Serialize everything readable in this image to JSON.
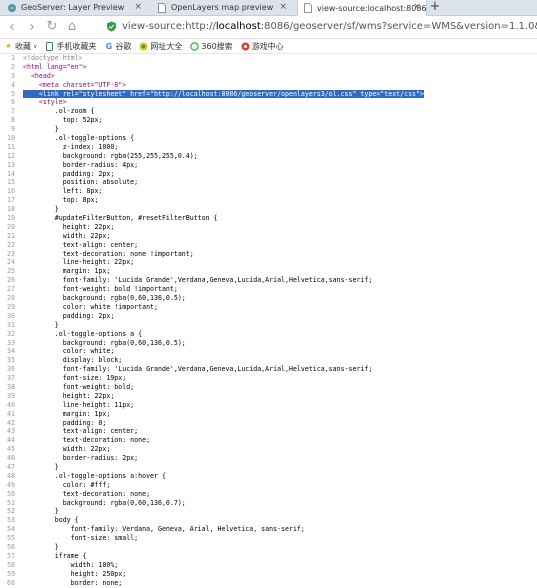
{
  "tabs": [
    {
      "title": "GeoServer: Layer Preview",
      "icon": "geoserver-icon",
      "active": false
    },
    {
      "title": "OpenLayers map preview",
      "icon": "page-icon",
      "active": false
    },
    {
      "title": "view-source:localhost:8086/ge",
      "icon": "page-icon",
      "active": true
    }
  ],
  "new_tab_label": "+",
  "close_label": "×",
  "nav": {
    "back": "‹",
    "forward": "›",
    "reload": "↻",
    "home": "⌂",
    "url_prefix": "view-source:http://",
    "url_host": "localhost",
    "url_rest": ":8086/geoserver/sf/wms?service=WMS&version=1.1.0&request=Ge"
  },
  "bookmarks": [
    {
      "label": "收藏",
      "icon": "star-icon"
    },
    {
      "label": "手机收藏夹",
      "icon": "phone-icon"
    },
    {
      "label": "谷歌",
      "icon": "google-icon"
    },
    {
      "label": "网址大全",
      "icon": "web-icon"
    },
    {
      "label": "360搜索",
      "icon": "search-360-icon"
    },
    {
      "label": "游戏中心",
      "icon": "game-icon"
    }
  ],
  "source_lines": [
    {
      "n": "1",
      "text": "<!doctype html>",
      "kind": "comment"
    },
    {
      "n": "2",
      "text": "<html lang=\"en\">",
      "kind": "tag"
    },
    {
      "n": "3",
      "text": "  <head>",
      "kind": "tag"
    },
    {
      "n": "4",
      "text": "    <meta charset=\"UTF-8\">",
      "kind": "tag"
    },
    {
      "n": "5",
      "text": "    <link rel=\"stylesheet\" href=\"http://localhost:8086/geoserver/openlayers3/ol.css\" type=\"text/css\">",
      "kind": "selected"
    },
    {
      "n": "6",
      "text": "    <style>",
      "kind": "tag"
    },
    {
      "n": "7",
      "text": "        .ol-zoom {",
      "kind": "code"
    },
    {
      "n": "8",
      "text": "          top: 52px;",
      "kind": "code"
    },
    {
      "n": "9",
      "text": "        }",
      "kind": "code"
    },
    {
      "n": "10",
      "text": "        .ol-toggle-options {",
      "kind": "code"
    },
    {
      "n": "11",
      "text": "          z-index: 1000;",
      "kind": "code"
    },
    {
      "n": "12",
      "text": "          background: rgba(255,255,255,0.4);",
      "kind": "code"
    },
    {
      "n": "13",
      "text": "          border-radius: 4px;",
      "kind": "code"
    },
    {
      "n": "14",
      "text": "          padding: 2px;",
      "kind": "code"
    },
    {
      "n": "15",
      "text": "          position: absolute;",
      "kind": "code"
    },
    {
      "n": "16",
      "text": "          left: 8px;",
      "kind": "code"
    },
    {
      "n": "17",
      "text": "          top: 8px;",
      "kind": "code"
    },
    {
      "n": "18",
      "text": "        }",
      "kind": "code"
    },
    {
      "n": "19",
      "text": "        #updateFilterButton, #resetFilterButton {",
      "kind": "code"
    },
    {
      "n": "20",
      "text": "          height: 22px;",
      "kind": "code"
    },
    {
      "n": "21",
      "text": "          width: 22px;",
      "kind": "code"
    },
    {
      "n": "22",
      "text": "          text-align: center;",
      "kind": "code"
    },
    {
      "n": "23",
      "text": "          text-decoration: none !important;",
      "kind": "code"
    },
    {
      "n": "24",
      "text": "          line-height: 22px;",
      "kind": "code"
    },
    {
      "n": "25",
      "text": "          margin: 1px;",
      "kind": "code"
    },
    {
      "n": "26",
      "text": "          font-family: 'Lucida Grande',Verdana,Geneva,Lucida,Arial,Helvetica,sans-serif;",
      "kind": "code"
    },
    {
      "n": "27",
      "text": "          font-weight: bold !important;",
      "kind": "code"
    },
    {
      "n": "28",
      "text": "          background: rgba(0,60,136,0.5);",
      "kind": "code"
    },
    {
      "n": "29",
      "text": "          color: white !important;",
      "kind": "code"
    },
    {
      "n": "30",
      "text": "          padding: 2px;",
      "kind": "code"
    },
    {
      "n": "31",
      "text": "        }",
      "kind": "code"
    },
    {
      "n": "32",
      "text": "        .ol-toggle-options a {",
      "kind": "code"
    },
    {
      "n": "33",
      "text": "          background: rgba(0,60,136,0.5);",
      "kind": "code"
    },
    {
      "n": "34",
      "text": "          color: white;",
      "kind": "code"
    },
    {
      "n": "35",
      "text": "          display: block;",
      "kind": "code"
    },
    {
      "n": "36",
      "text": "          font-family: 'Lucida Grande',Verdana,Geneva,Lucida,Arial,Helvetica,sans-serif;",
      "kind": "code"
    },
    {
      "n": "37",
      "text": "          font-size: 19px;",
      "kind": "code"
    },
    {
      "n": "38",
      "text": "          font-weight: bold;",
      "kind": "code"
    },
    {
      "n": "39",
      "text": "          height: 22px;",
      "kind": "code"
    },
    {
      "n": "40",
      "text": "          line-height: 11px;",
      "kind": "code"
    },
    {
      "n": "41",
      "text": "          margin: 1px;",
      "kind": "code"
    },
    {
      "n": "42",
      "text": "          padding: 0;",
      "kind": "code"
    },
    {
      "n": "43",
      "text": "          text-align: center;",
      "kind": "code"
    },
    {
      "n": "44",
      "text": "          text-decoration: none;",
      "kind": "code"
    },
    {
      "n": "45",
      "text": "          width: 22px;",
      "kind": "code"
    },
    {
      "n": "46",
      "text": "          border-radius: 2px;",
      "kind": "code"
    },
    {
      "n": "47",
      "text": "        }",
      "kind": "code"
    },
    {
      "n": "48",
      "text": "        .ol-toggle-options a:hover {",
      "kind": "code"
    },
    {
      "n": "49",
      "text": "          color: #fff;",
      "kind": "code"
    },
    {
      "n": "50",
      "text": "          text-decoration: none;",
      "kind": "code"
    },
    {
      "n": "51",
      "text": "          background: rgba(0,60,136,0.7);",
      "kind": "code"
    },
    {
      "n": "52",
      "text": "        }",
      "kind": "code"
    },
    {
      "n": "53",
      "text": "        body {",
      "kind": "code"
    },
    {
      "n": "54",
      "text": "            font-family: Verdana, Geneva, Arial, Helvetica, sans-serif;",
      "kind": "code"
    },
    {
      "n": "55",
      "text": "            font-size: small;",
      "kind": "code"
    },
    {
      "n": "56",
      "text": "        }",
      "kind": "code"
    },
    {
      "n": "57",
      "text": "        iframe {",
      "kind": "code"
    },
    {
      "n": "58",
      "text": "            width: 100%;",
      "kind": "code"
    },
    {
      "n": "59",
      "text": "            height: 250px;",
      "kind": "code"
    },
    {
      "n": "60",
      "text": "            border: none;",
      "kind": "code"
    }
  ],
  "colors": {
    "tabbar_bg": "#dde3ea",
    "selection": "#316ac5",
    "tag": "#881280",
    "comment": "#8a8a8a",
    "line_number": "#9a9a9a"
  }
}
